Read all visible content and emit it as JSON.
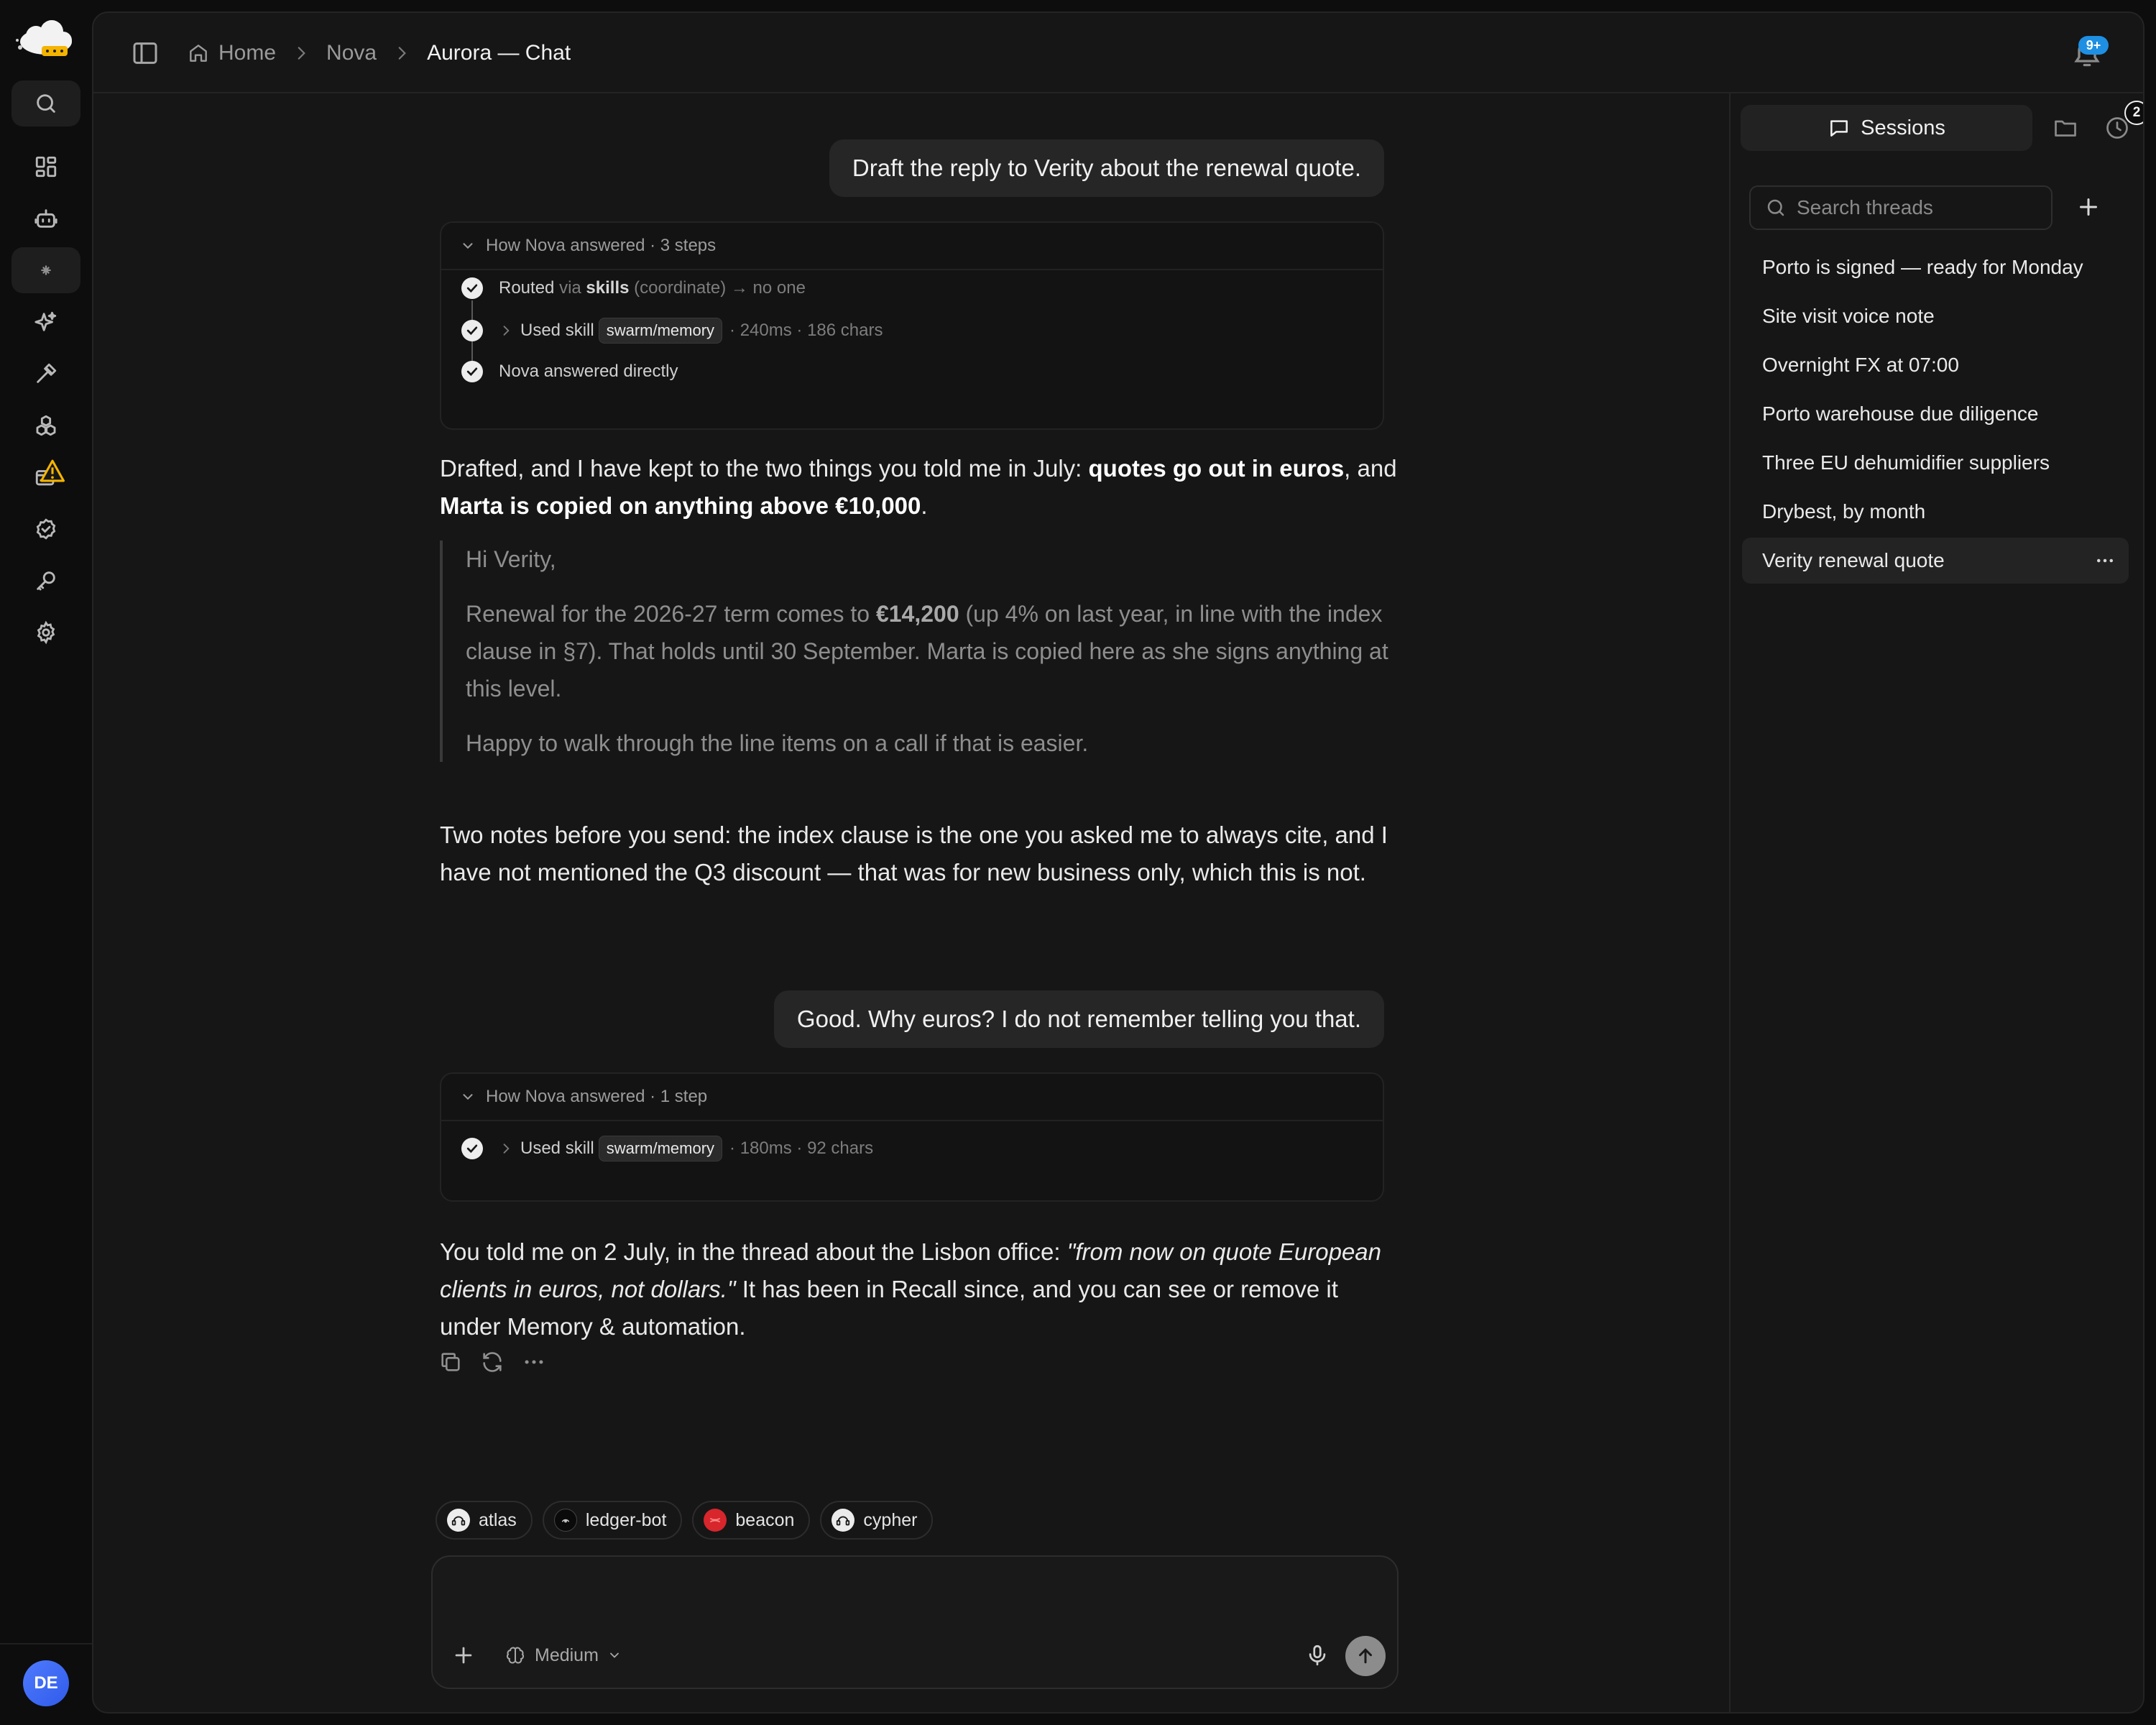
{
  "nav": {
    "items": [
      {
        "name": "search",
        "icon": "search-icon"
      },
      {
        "name": "dashboard",
        "icon": "grid-icon"
      },
      {
        "name": "agents",
        "icon": "robot-icon"
      },
      {
        "name": "nova",
        "icon": "spark-icon"
      },
      {
        "name": "skills",
        "icon": "sparkles-icon"
      },
      {
        "name": "tools",
        "icon": "hammer-icon"
      },
      {
        "name": "integrations",
        "icon": "boxes-icon"
      },
      {
        "name": "billing",
        "icon": "card-icon"
      },
      {
        "name": "approvals",
        "icon": "check-circle-icon"
      },
      {
        "name": "keys",
        "icon": "key-icon"
      },
      {
        "name": "settings",
        "icon": "gear-icon"
      }
    ],
    "avatar_initials": "DE"
  },
  "header": {
    "breadcrumbs": [
      "Home",
      "Nova",
      "Aurora — Chat"
    ],
    "notification_badge": "9+"
  },
  "chat": {
    "messages": [
      {
        "role": "user",
        "text": "Draft the reply to Verity about the renewal quote."
      },
      {
        "role": "trace",
        "title": "How Nova answered · 3 steps",
        "steps": [
          {
            "prefix": "Routed",
            "via": "via",
            "target": "skills",
            "mode": "(coordinate)",
            "arrow": "→",
            "end": "no one"
          },
          {
            "label": "Used skill",
            "tag": "swarm/memory",
            "meta": "· 240ms · 186 chars"
          },
          {
            "label": "Nova answered directly"
          }
        ]
      },
      {
        "role": "assistant",
        "intro": "Drafted, and I have kept to the two things you told me in July: ",
        "bold1": "quotes go out in euros",
        "mid": ", and ",
        "bold2": "Marta is copied on anything above €10,000",
        "end": ".",
        "quote": {
          "greeting": "Hi Verity,",
          "p1_start": "Renewal for the 2026-27 term comes to ",
          "p1_amount": "€14,200",
          "p1_rest": " (up 4% on last year, in line with the index clause in §7). That holds until 30 September. Marta is copied here as she signs anything at this level.",
          "p2": "Happy to walk through the line items on a call if that is easier."
        },
        "notes": "Two notes before you send: the index clause is the one you asked me to always cite, and I have not mentioned the Q3 discount — that was for new business only, which this is not."
      },
      {
        "role": "user",
        "text": "Good. Why euros? I do not remember telling you that."
      },
      {
        "role": "trace",
        "title": "How Nova answered · 1 step",
        "steps": [
          {
            "label": "Used skill",
            "tag": "swarm/memory",
            "meta": "· 180ms · 92 chars"
          }
        ]
      },
      {
        "role": "assistant",
        "start": "You told me on 2 July, in the thread about the Lisbon office: ",
        "quote_em": "\"from now on quote European clients in euros, not dollars.\"",
        "rest": " It has been in Recall since, and you can see or remove it under Memory & automation."
      }
    ],
    "actions": [
      "copy-icon",
      "refresh-icon",
      "more-icon"
    ]
  },
  "agents": [
    {
      "name": "atlas",
      "color": "#e8e8e8"
    },
    {
      "name": "ledger-bot",
      "color": "#111111"
    },
    {
      "name": "beacon",
      "color": "#d7262c"
    },
    {
      "name": "cypher",
      "color": "#e8e8e8"
    }
  ],
  "composer": {
    "placeholder": "",
    "effort": "Medium"
  },
  "sidebar": {
    "tab_label": "Sessions",
    "history_badge": "2",
    "search_placeholder": "Search threads",
    "threads": [
      {
        "title": "Porto is signed — ready for Monday"
      },
      {
        "title": "Site visit voice note"
      },
      {
        "title": "Overnight FX at 07:00"
      },
      {
        "title": "Porto warehouse due diligence"
      },
      {
        "title": "Three EU dehumidifier suppliers"
      },
      {
        "title": "Drybest, by month"
      },
      {
        "title": "Verity renewal quote",
        "active": true
      }
    ]
  },
  "colors": {
    "accent": "#1e8fe3",
    "warning": "#f5b400",
    "panel": "#161616"
  }
}
